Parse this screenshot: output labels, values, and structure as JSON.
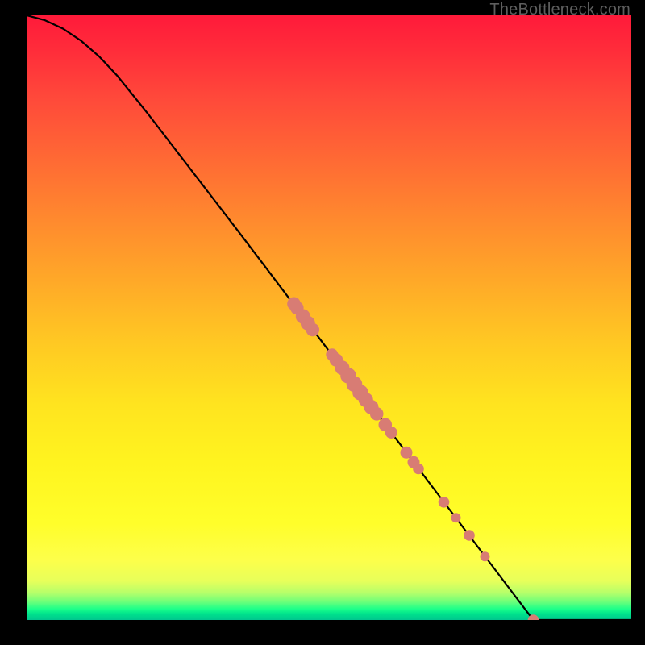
{
  "watermark": "TheBottleneck.com",
  "colors": {
    "frame": "#000000",
    "curve": "#000000",
    "point": "#d87c74",
    "gradient_top": "#ff1a3a",
    "gradient_bottom": "#00c68e"
  },
  "chart_data": {
    "type": "line",
    "title": "",
    "xlabel": "",
    "ylabel": "",
    "xlim": [
      0,
      100
    ],
    "ylim": [
      0,
      100
    ],
    "grid": false,
    "curve": [
      {
        "x": 0.0,
        "y": 100.0
      },
      {
        "x": 3.0,
        "y": 99.2
      },
      {
        "x": 6.0,
        "y": 97.8
      },
      {
        "x": 9.0,
        "y": 95.8
      },
      {
        "x": 12.0,
        "y": 93.2
      },
      {
        "x": 15.0,
        "y": 90.0
      },
      {
        "x": 20.0,
        "y": 83.8
      },
      {
        "x": 25.0,
        "y": 77.3
      },
      {
        "x": 30.0,
        "y": 70.8
      },
      {
        "x": 35.0,
        "y": 64.3
      },
      {
        "x": 40.0,
        "y": 57.7
      },
      {
        "x": 45.0,
        "y": 51.1
      },
      {
        "x": 50.0,
        "y": 44.5
      },
      {
        "x": 55.0,
        "y": 38.0
      },
      {
        "x": 60.0,
        "y": 31.4
      },
      {
        "x": 65.0,
        "y": 24.8
      },
      {
        "x": 70.0,
        "y": 18.2
      },
      {
        "x": 75.0,
        "y": 11.6
      },
      {
        "x": 80.0,
        "y": 5.0
      },
      {
        "x": 83.8,
        "y": 0.0
      },
      {
        "x": 100.0,
        "y": 0.0
      }
    ],
    "points": [
      {
        "x": 44.2,
        "y": 52.3,
        "r": 1.1
      },
      {
        "x": 44.7,
        "y": 51.6,
        "r": 1.1
      },
      {
        "x": 45.7,
        "y": 50.2,
        "r": 1.2
      },
      {
        "x": 46.5,
        "y": 49.1,
        "r": 1.2
      },
      {
        "x": 47.3,
        "y": 48.0,
        "r": 1.1
      },
      {
        "x": 50.5,
        "y": 43.9,
        "r": 1.0
      },
      {
        "x": 51.2,
        "y": 43.0,
        "r": 1.1
      },
      {
        "x": 52.2,
        "y": 41.7,
        "r": 1.2
      },
      {
        "x": 53.2,
        "y": 40.4,
        "r": 1.3
      },
      {
        "x": 54.2,
        "y": 39.0,
        "r": 1.3
      },
      {
        "x": 55.2,
        "y": 37.6,
        "r": 1.3
      },
      {
        "x": 56.1,
        "y": 36.4,
        "r": 1.2
      },
      {
        "x": 57.0,
        "y": 35.2,
        "r": 1.2
      },
      {
        "x": 57.9,
        "y": 34.1,
        "r": 1.1
      },
      {
        "x": 59.3,
        "y": 32.3,
        "r": 1.1
      },
      {
        "x": 60.3,
        "y": 31.0,
        "r": 1.0
      },
      {
        "x": 62.8,
        "y": 27.7,
        "r": 1.0
      },
      {
        "x": 64.0,
        "y": 26.1,
        "r": 1.0
      },
      {
        "x": 64.8,
        "y": 25.0,
        "r": 0.9
      },
      {
        "x": 69.0,
        "y": 19.5,
        "r": 0.9
      },
      {
        "x": 71.0,
        "y": 16.9,
        "r": 0.8
      },
      {
        "x": 73.2,
        "y": 14.0,
        "r": 0.9
      },
      {
        "x": 75.8,
        "y": 10.5,
        "r": 0.8
      },
      {
        "x": 83.8,
        "y": 0.0,
        "r": 0.9
      }
    ]
  }
}
